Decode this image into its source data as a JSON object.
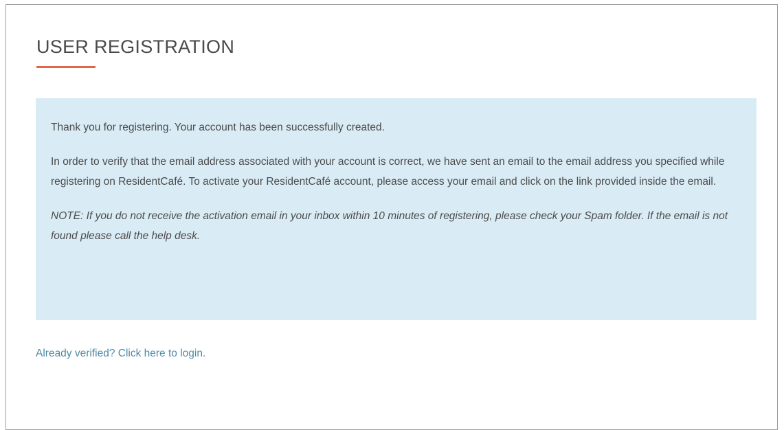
{
  "page": {
    "title": "USER REGISTRATION"
  },
  "message": {
    "success_text": "Thank you for registering. Your account has been successfully created.",
    "verify_text": "In order to verify that the email address associated with your account is correct, we have sent an email to the email address you specified while registering on ResidentCafé. To activate your ResidentCafé account, please access your email and click on the link provided inside the email.",
    "note_text": "NOTE: If you do not receive the activation email in your inbox within 10 minutes of registering, please check your Spam folder. If the email is not found please call the help desk."
  },
  "footer": {
    "login_link": "Already verified? Click here to login."
  },
  "colors": {
    "accent_underline": "#e2674a",
    "message_background": "#d9ebf5",
    "link": "#4f8aa6",
    "text": "#4b4b4b"
  }
}
